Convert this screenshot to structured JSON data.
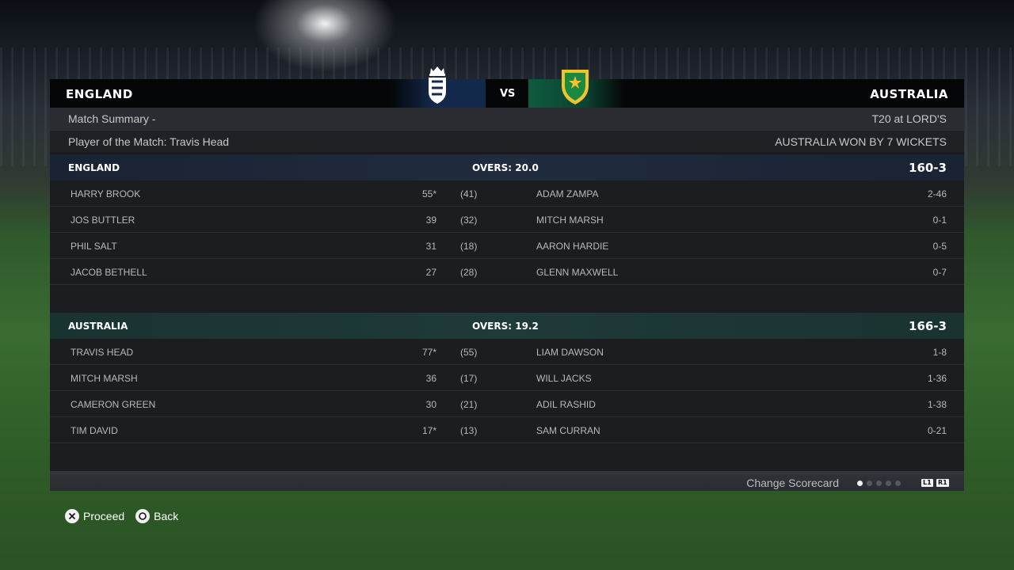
{
  "header": {
    "home_team": "ENGLAND",
    "away_team": "AUSTRALIA",
    "vs": "VS"
  },
  "summary": {
    "title": "Match Summary  -",
    "format_venue": "T20 at LORD'S",
    "player_of_match": "Player of the Match: Travis Head",
    "result": "AUSTRALIA WON BY 7 WICKETS"
  },
  "innings": [
    {
      "team": "ENGLAND",
      "overs": "OVERS: 20.0",
      "score": "160-3",
      "rows": [
        {
          "batter": "HARRY BROOK",
          "runs": "55*",
          "balls": "(41)",
          "bowler": "ADAM ZAMPA",
          "figures": "2-46"
        },
        {
          "batter": "JOS BUTTLER",
          "runs": "39",
          "balls": "(32)",
          "bowler": "MITCH MARSH",
          "figures": "0-1"
        },
        {
          "batter": "PHIL SALT",
          "runs": "31",
          "balls": "(18)",
          "bowler": "AARON HARDIE",
          "figures": "0-5"
        },
        {
          "batter": "JACOB BETHELL",
          "runs": "27",
          "balls": "(28)",
          "bowler": "GLENN MAXWELL",
          "figures": "0-7"
        }
      ]
    },
    {
      "team": "AUSTRALIA",
      "overs": "OVERS: 19.2",
      "score": "166-3",
      "rows": [
        {
          "batter": "TRAVIS HEAD",
          "runs": "77*",
          "balls": "(55)",
          "bowler": "LIAM DAWSON",
          "figures": "1-8"
        },
        {
          "batter": "MITCH MARSH",
          "runs": "36",
          "balls": "(17)",
          "bowler": "WILL JACKS",
          "figures": "1-36"
        },
        {
          "batter": "CAMERON GREEN",
          "runs": "30",
          "balls": "(21)",
          "bowler": "ADIL RASHID",
          "figures": "1-38"
        },
        {
          "batter": "TIM DAVID",
          "runs": "17*",
          "balls": "(13)",
          "bowler": "SAM CURRAN",
          "figures": "0-21"
        }
      ]
    }
  ],
  "footer": {
    "change_scorecard": "Change Scorecard",
    "page_count": 5,
    "active_page": 1,
    "l1": "L1",
    "r1": "R1"
  },
  "prompts": {
    "proceed": "Proceed",
    "back": "Back",
    "proceed_icon": "cross-button-icon",
    "back_icon": "circle-button-icon"
  },
  "colors": {
    "england_accent": "#13294b",
    "australia_accent": "#0e5a3f",
    "australia_gold": "#f2c230"
  }
}
